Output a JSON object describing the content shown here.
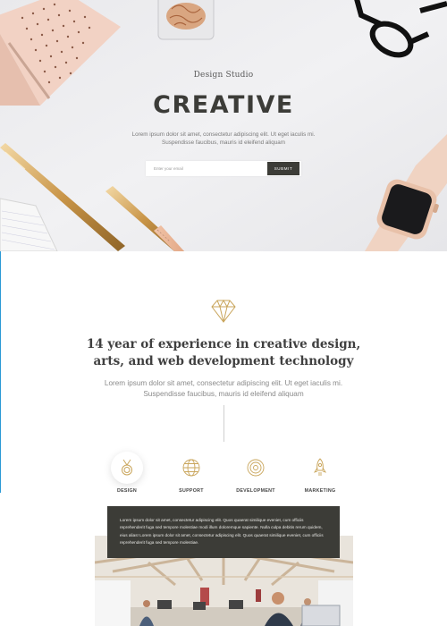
{
  "hero": {
    "subtitle": "Design Studio",
    "title": "CREATIVE",
    "text": "Lorem ipsum dolor sit amet, consectetur adipiscing elit. Ut eget iaculis mi. Suspendisse faucibus, mauris id eleifend aliquam",
    "email_placeholder": "Enter your email",
    "submit_label": "SUBMIT"
  },
  "about": {
    "heading": "14 year of experience in creative design, arts, and web development technology",
    "text": "Lorem ipsum dolor sit amet, consectetur adipiscing elit. Ut eget iaculis mi. Suspendisse faucibus, mauris id eleifend aliquam"
  },
  "services": [
    {
      "label": "DESIGN",
      "icon": "medal-icon",
      "active": true
    },
    {
      "label": "SUPPORT",
      "icon": "globe-icon",
      "active": false
    },
    {
      "label": "DEVELOPMENT",
      "icon": "target-icon",
      "active": false
    },
    {
      "label": "MARKETING",
      "icon": "rocket-icon",
      "active": false
    }
  ],
  "panel": {
    "text": "Lorem ipsum dolor sit amet, consectetur adipiscing elit. Quos quaerat similique eveniet, cum officiis reprehenderit fuga sed tempore molestiae modi illum doloremque sapiente. Nulla culpa debitis rerum quidem, eius alias! Lorem ipsum dolor sit amet, consectetur adipiscing elit. Quos quaerat similique eveniet, cum officiis reprehenderit fuga sed tempore molestiae."
  },
  "colors": {
    "accent_gold": "#c9a55b",
    "dark": "#3c3c37",
    "hero_bg": "#eeeef0",
    "edge_line": "#2c9ad6"
  }
}
